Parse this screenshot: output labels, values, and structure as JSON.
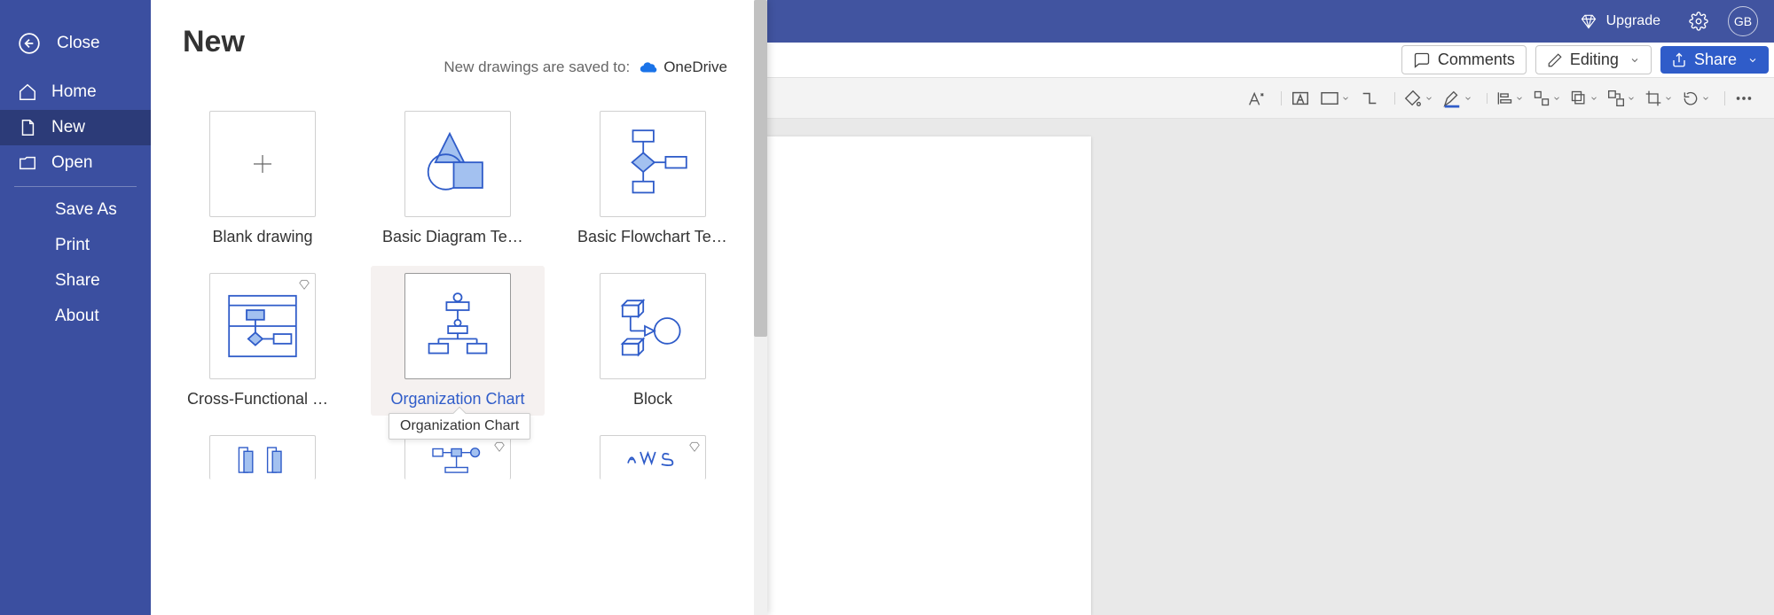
{
  "topbar": {
    "upgrade": "Upgrade",
    "initials": "GB"
  },
  "ribbon": {
    "comments": "Comments",
    "editing": "Editing",
    "share": "Share"
  },
  "backstage": {
    "close": "Close",
    "nav": {
      "home": "Home",
      "new": "New",
      "open": "Open",
      "save_as": "Save As",
      "print": "Print",
      "share": "Share",
      "about": "About"
    },
    "panel": {
      "title": "New",
      "saved_prefix": "New drawings are saved to:",
      "saved_location": "OneDrive"
    },
    "templates": [
      {
        "label": "Blank drawing",
        "premium": false
      },
      {
        "label": "Basic Diagram Temp…",
        "premium": false
      },
      {
        "label": "Basic Flowchart Tem…",
        "premium": false
      },
      {
        "label": "Cross-Functional Flo…",
        "premium": true
      },
      {
        "label": "Organization Chart",
        "premium": false,
        "hover": true
      },
      {
        "label": "Block",
        "premium": false
      },
      {
        "label": "",
        "premium": false
      },
      {
        "label": "",
        "premium": true
      },
      {
        "label": "",
        "premium": true
      }
    ],
    "tooltip": "Organization Chart"
  }
}
